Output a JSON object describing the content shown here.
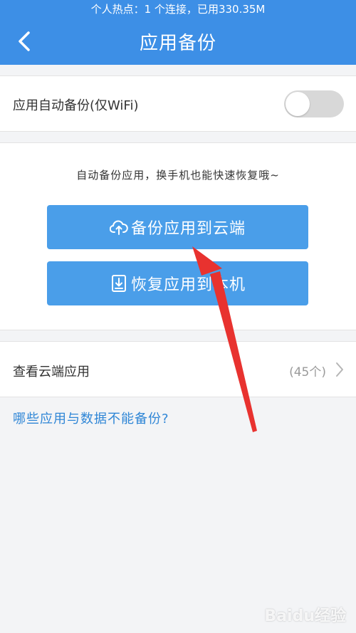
{
  "status_bar": {
    "text": "个人热点：1 个连接，已用330.35M"
  },
  "header": {
    "title": "应用备份",
    "back_icon": "chevron-left-icon"
  },
  "auto_backup": {
    "label": "应用自动备份(仅WiFi)",
    "toggle_state": "off"
  },
  "backup_panel": {
    "hint": "自动备份应用，换手机也能快速恢复哦~",
    "backup_button": {
      "label": "备份应用到云端",
      "icon": "cloud-upload-icon"
    },
    "restore_button": {
      "label": "恢复应用到本机",
      "icon": "download-icon"
    }
  },
  "cloud_apps": {
    "label": "查看云端应用",
    "count": "(45个)",
    "icon": "chevron-right-icon"
  },
  "faq_link": "哪些应用与数据不能备份?",
  "watermark": "Baidu经验",
  "colors": {
    "primary": "#3d8fe6",
    "button": "#4a9ee9",
    "link": "#2f86d6",
    "annotation": "#e8322f"
  }
}
